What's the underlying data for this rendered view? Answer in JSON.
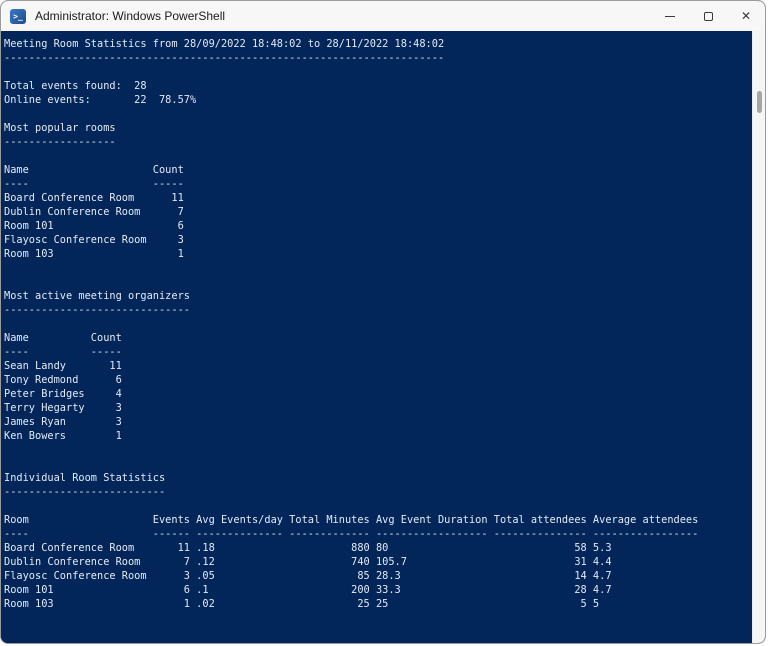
{
  "window": {
    "title": "Administrator: Windows PowerShell",
    "icon": "powershell-icon",
    "icon_glyph": ">_",
    "controls": [
      {
        "name": "minimize"
      },
      {
        "name": "maximize"
      },
      {
        "name": "close",
        "glyph": "✕"
      }
    ]
  },
  "theme": {
    "console_bg": "#02265A",
    "console_fg": "#E4EAF4",
    "titlebar_bg": "#F7F7F7",
    "titlebar_fg": "#1B1B1B",
    "scrollbar_track": "#F5F5F5",
    "scrollbar_thumb": "#A6A6A6"
  },
  "console": {
    "blocks": [
      {
        "type": "heading",
        "text": "Meeting Room Statistics from 28/09/2022 18:48:02 to 28/11/2022 18:48:02"
      },
      {
        "type": "blank",
        "count": 1
      },
      {
        "type": "kv",
        "label_width": 21,
        "rows": [
          {
            "label": "Total events found:",
            "value": "28",
            "extra": ""
          },
          {
            "label": "Online events:",
            "value": "22",
            "extra": "78.57%"
          }
        ]
      },
      {
        "type": "blank",
        "count": 1
      },
      {
        "type": "heading",
        "text": "Most popular rooms"
      },
      {
        "type": "blank",
        "count": 1
      },
      {
        "type": "table",
        "columns": [
          {
            "header": "Name",
            "width": 23,
            "align": "left"
          },
          {
            "header": "Count",
            "width": 5,
            "align": "right"
          }
        ],
        "rows": [
          [
            "Board Conference Room",
            "11"
          ],
          [
            "Dublin Conference Room",
            "7"
          ],
          [
            "Room 101",
            "6"
          ],
          [
            "Flayosc Conference Room",
            "3"
          ],
          [
            "Room 103",
            "1"
          ]
        ]
      },
      {
        "type": "blank",
        "count": 2
      },
      {
        "type": "heading",
        "text": "Most active meeting organizers"
      },
      {
        "type": "blank",
        "count": 1
      },
      {
        "type": "table",
        "columns": [
          {
            "header": "Name",
            "width": 13,
            "align": "left"
          },
          {
            "header": "Count",
            "width": 5,
            "align": "right"
          }
        ],
        "rows": [
          [
            "Sean Landy",
            "11"
          ],
          [
            "Tony Redmond",
            "6"
          ],
          [
            "Peter Bridges",
            "4"
          ],
          [
            "Terry Hegarty",
            "3"
          ],
          [
            "James Ryan",
            "3"
          ],
          [
            "Ken Bowers",
            "1"
          ]
        ]
      },
      {
        "type": "blank",
        "count": 2
      },
      {
        "type": "heading",
        "text": "Individual Room Statistics"
      },
      {
        "type": "blank",
        "count": 1
      },
      {
        "type": "table",
        "columns": [
          {
            "header": "Room",
            "width": 23,
            "align": "left"
          },
          {
            "header": "Events",
            "width": 6,
            "align": "right"
          },
          {
            "header": "Avg Events/day",
            "width": 14,
            "align": "left"
          },
          {
            "header": "Total Minutes",
            "width": 13,
            "align": "right"
          },
          {
            "header": "Avg Event Duration",
            "width": 18,
            "align": "left"
          },
          {
            "header": "Total attendees",
            "width": 15,
            "align": "right"
          },
          {
            "header": "Average attendees",
            "width": 17,
            "align": "left"
          }
        ],
        "rows": [
          [
            "Board Conference Room",
            "11",
            ".18",
            "880",
            "80",
            "58",
            "5.3"
          ],
          [
            "Dublin Conference Room",
            "7",
            ".12",
            "740",
            "105.7",
            "31",
            "4.4"
          ],
          [
            "Flayosc Conference Room",
            "3",
            ".05",
            "85",
            "28.3",
            "14",
            "4.7"
          ],
          [
            "Room 101",
            "6",
            ".1",
            "200",
            "33.3",
            "28",
            "4.7"
          ],
          [
            "Room 103",
            "1",
            ".02",
            "25",
            "25",
            "5",
            "5"
          ]
        ]
      }
    ]
  }
}
